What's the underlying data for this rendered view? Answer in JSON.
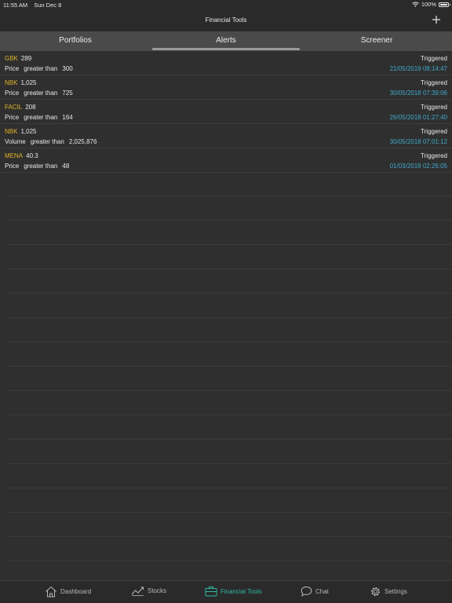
{
  "status_bar": {
    "time": "11:55 AM",
    "date": "Sun Dec 8",
    "battery": "100%"
  },
  "nav": {
    "title": "Financial Tools",
    "add_icon": "plus-icon"
  },
  "tabs": [
    {
      "label": "Portfolios"
    },
    {
      "label": "Alerts",
      "selected": true
    },
    {
      "label": "Screener"
    }
  ],
  "alerts": [
    {
      "ticker": "GBK",
      "price": "289",
      "field": "Price",
      "condition": "greater than",
      "threshold": "300",
      "status": "Triggered",
      "time": "21/05/2019 08:14:47"
    },
    {
      "ticker": "NBK",
      "price": "1,025",
      "field": "Price",
      "condition": "greater than",
      "threshold": "725",
      "status": "Triggered",
      "time": "30/05/2018 07:39:06"
    },
    {
      "ticker": "FACIL",
      "price": "208",
      "field": "Price",
      "condition": "greater than",
      "threshold": "164",
      "status": "Triggered",
      "time": "26/05/2018 01:27:40"
    },
    {
      "ticker": "NBK",
      "price": "1,025",
      "field": "Volume",
      "condition": "greater than",
      "threshold": "2,025,876",
      "status": "Triggered",
      "time": "30/05/2018 07:01:12"
    },
    {
      "ticker": "MENA",
      "price": "40.3",
      "field": "Price",
      "condition": "greater than",
      "threshold": "48",
      "status": "Triggered",
      "time": "01/03/2019 02:26:05"
    }
  ],
  "bottom_tabs": [
    {
      "label": "Dashboard",
      "icon": "home-icon"
    },
    {
      "label": "Stocks",
      "icon": "stocks-chart-icon"
    },
    {
      "label": "Financial Tools",
      "icon": "briefcase-icon",
      "active": true
    },
    {
      "label": "Chat",
      "icon": "chat-icon"
    },
    {
      "label": "Settings",
      "icon": "gear-icon"
    }
  ],
  "colors": {
    "ticker": "#e0b32a",
    "timestamp": "#3fa8c9",
    "active_tab": "#2fb8a0",
    "background": "#2f2f2f"
  }
}
